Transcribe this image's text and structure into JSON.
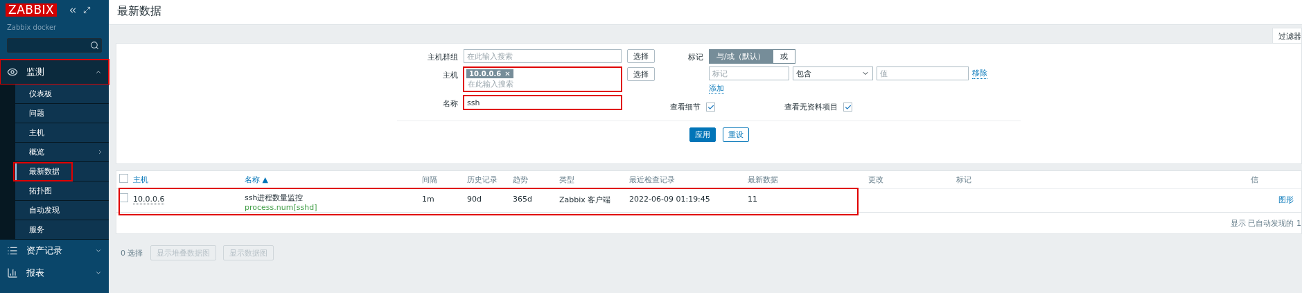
{
  "sidebar": {
    "logo": "ZABBIX",
    "server": "Zabbix docker",
    "menu": [
      {
        "label": "监测",
        "expanded": true,
        "highlighted": true,
        "children": [
          {
            "label": "仪表板",
            "selected": false,
            "highlighted": false,
            "has_submenu": false
          },
          {
            "label": "问题",
            "selected": false,
            "highlighted": false,
            "has_submenu": false
          },
          {
            "label": "主机",
            "selected": false,
            "highlighted": false,
            "has_submenu": false
          },
          {
            "label": "概览",
            "selected": false,
            "highlighted": false,
            "has_submenu": true
          },
          {
            "label": "最新数据",
            "selected": true,
            "highlighted": true,
            "has_submenu": false
          },
          {
            "label": "拓扑图",
            "selected": false,
            "highlighted": false,
            "has_submenu": false
          },
          {
            "label": "自动发现",
            "selected": false,
            "highlighted": false,
            "has_submenu": false
          },
          {
            "label": "服务",
            "selected": false,
            "highlighted": false,
            "has_submenu": false
          }
        ]
      },
      {
        "label": "资产记录",
        "expanded": false,
        "highlighted": false
      },
      {
        "label": "报表",
        "expanded": false,
        "highlighted": false
      }
    ]
  },
  "page_title": "最新数据",
  "filter": {
    "tab": "过滤器",
    "host_groups": {
      "label": "主机群组",
      "placeholder": "在此输入搜索",
      "button": "选择"
    },
    "hosts": {
      "label": "主机",
      "tags": [
        {
          "text": "10.0.0.6",
          "remove": "✕"
        }
      ],
      "placeholder": "在此输入搜索",
      "button": "选择",
      "highlighted": true
    },
    "name": {
      "label": "名称",
      "value": "ssh",
      "highlighted": true
    },
    "tags": {
      "label": "标记",
      "options": [
        {
          "label": "与/或（默认）",
          "selected": true
        },
        {
          "label": "或",
          "selected": false
        }
      ],
      "row": {
        "tag_placeholder": "标记",
        "operator": "包含",
        "value_placeholder": "值",
        "remove": "移除"
      },
      "add": "添加"
    },
    "show_details": {
      "label": "查看细节",
      "checked": true
    },
    "show_without_data": {
      "label": "查看无资料项目",
      "checked": true
    },
    "apply": "应用",
    "reset": "重设"
  },
  "table": {
    "all_checked": false,
    "columns": [
      "主机",
      "名称 ▲",
      "间隔",
      "历史记录",
      "趋势",
      "类型",
      "最近检查记录",
      "最新数据",
      "更改",
      "标记",
      "信"
    ],
    "rows": [
      {
        "checked": false,
        "highlighted": true,
        "host": "10.0.0.6",
        "name": "ssh进程数量监控",
        "key": "process.num[sshd]",
        "interval": "1m",
        "history": "90d",
        "trends": "365d",
        "type": "Zabbix 客户端",
        "last_check": "2022-06-09 01:19:45",
        "last_value": "11",
        "graph": "图形"
      }
    ],
    "footer": "显示 已自动发现的 1"
  },
  "actions": {
    "selected": "0 选择",
    "buttons": [
      {
        "label": "显示堆叠数据图",
        "disabled": true
      },
      {
        "label": "显示数据图",
        "disabled": true
      }
    ]
  }
}
